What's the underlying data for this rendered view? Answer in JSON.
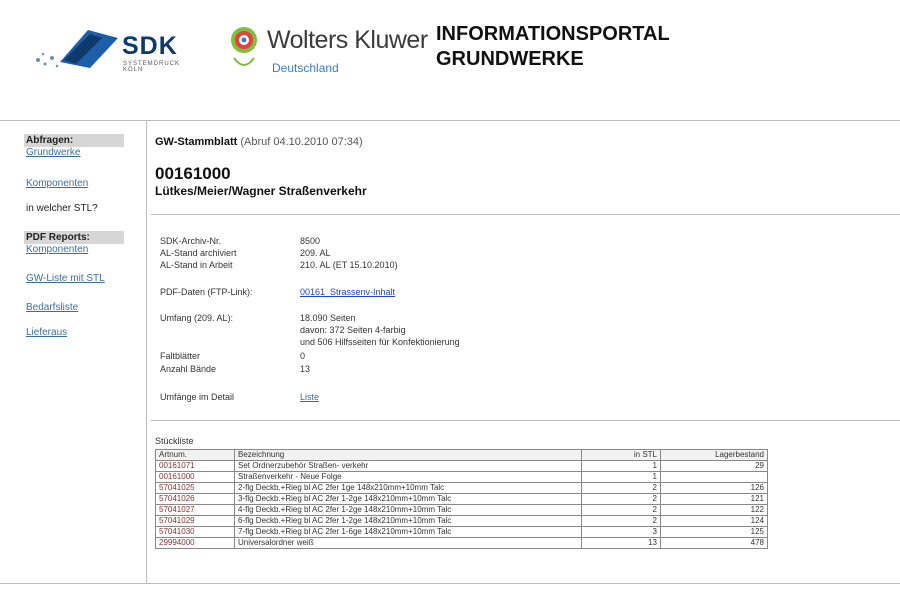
{
  "header": {
    "sdk_logo": {
      "text": "SDK",
      "subtext": "SYSTEMDRUCK KÖLN"
    },
    "wk_logo": {
      "name": "Wolters Kluwer",
      "country": "Deutschland"
    },
    "title_line1": "INFORMATIONSPORTAL",
    "title_line2": "GRUNDWERKE"
  },
  "sidebar": {
    "abfragen_heading": "Abfragen:",
    "grundwerke": "Grundwerke",
    "komponenten": "Komponenten",
    "in_welcher_stl": "in welcher STL?",
    "pdf_heading": "PDF Reports:",
    "pdf_komponenten": "Komponenten",
    "gw_liste": "GW-Liste mit STL",
    "bedarfsliste": "Bedarfsliste",
    "lieferung": "Lieferaus"
  },
  "main": {
    "stammblatt_label": "GW-Stammblatt",
    "abruf": "(Abruf 04.10.2010 07:34)",
    "gw_number": "00161000",
    "gw_title": "Lütkes/Meier/Wagner Straßenverkehr",
    "info": {
      "sdk_archiv_label": "SDK-Archiv-Nr.",
      "sdk_archiv_value": "8500",
      "al_archiviert_label": "AL-Stand archiviert",
      "al_archiviert_value": "209. AL",
      "al_arbeit_label": "AL-Stand in Arbeit",
      "al_arbeit_value": "210. AL (ET 15.10.2010)",
      "pdf_label": "PDF-Daten (FTP-Link):",
      "pdf_value": "00161_Strassenv-Inhalt",
      "umfang_label": "Umfang (209. AL):",
      "umfang_line1": "18.090 Seiten",
      "umfang_line2": "davon: 372 Seiten 4-farbig",
      "umfang_line3": "und 506 Hilfsseiten für Konfektionierung",
      "faltblaetter_label": "Faltblätter",
      "faltblaetter_value": "0",
      "baende_label": "Anzahl Bände",
      "baende_value": "13",
      "umfaenge_label": "Umfänge im Detail",
      "umfaenge_value": "Liste"
    },
    "stueckliste_label": "Stückliste",
    "table": {
      "headers": [
        "Artnum.",
        "Bezeichnung",
        "in STL",
        "Lagerbestand"
      ],
      "rows": [
        [
          "00161071",
          "Set Ordnerzubehör Straßen- verkehr",
          "1",
          "29"
        ],
        [
          "00161000",
          "Straßenverkehr - Neue Folge",
          "1",
          ""
        ],
        [
          "57041025",
          "2-flg Deckb.+Rieg bl AC 2fer 1ge 148x210mm+10mm Talc",
          "2",
          "126"
        ],
        [
          "57041026",
          "3-flg Deckb.+Rieg bl AC 2fer 1-2ge 148x210mm+10mm Talc",
          "2",
          "121"
        ],
        [
          "57041027",
          "4-flg Deckb.+Rieg bl AC 2fer 1-2ge 148x210mm+10mm Talc",
          "2",
          "122"
        ],
        [
          "57041029",
          "6-flg Deckb.+Rieg bl AC 2fer 1-2ge 148x210mm+10mm Talc",
          "2",
          "124"
        ],
        [
          "57041030",
          "7-flg Deckb.+Rieg bl AC 2fer 1-6ge 148x210mm+10mm Talc",
          "3",
          "125"
        ],
        [
          "29994000",
          "Universalordner weiß",
          "13",
          "478"
        ]
      ]
    }
  },
  "colors": {
    "link": "#3a6e9f",
    "sdk_blue": "#0f3a6b",
    "wk_blue": "#3b7dc4"
  }
}
